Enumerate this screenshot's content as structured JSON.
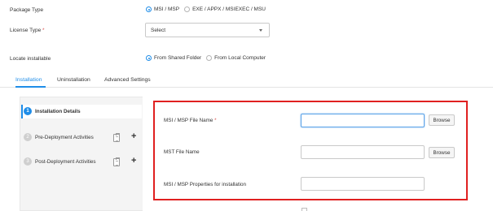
{
  "form": {
    "package_type_label": "Package Type",
    "package_type_options": [
      {
        "label": "MSI / MSP",
        "selected": true
      },
      {
        "label": "EXE / APPX / MSIEXEC / MSU",
        "selected": false
      }
    ],
    "license_type_label": "License Type",
    "required_mark": "*",
    "license_type_value": "Select",
    "locate_label": "Locate installable",
    "locate_options": [
      {
        "label": "From Shared Folder",
        "selected": true
      },
      {
        "label": "From Local Computer",
        "selected": false
      }
    ]
  },
  "tabs": [
    {
      "label": "Installation",
      "active": true
    },
    {
      "label": "Uninstallation",
      "active": false
    },
    {
      "label": "Advanced Settings",
      "active": false
    }
  ],
  "steps": [
    {
      "number": "1",
      "label": "Installation Details",
      "active": true
    },
    {
      "number": "2",
      "label": "Pre-Deployment Activities",
      "active": false
    },
    {
      "number": "3",
      "label": "Post-Deployment Activities",
      "active": false
    }
  ],
  "details": {
    "msi_file_label": "MSI / MSP File Name",
    "msi_file_value": "",
    "mst_file_label": "MST File Name",
    "mst_file_value": "",
    "properties_label": "MSI / MSP Properties for installation",
    "properties_value": "",
    "browse_label": "Browse"
  },
  "colors": {
    "accent": "#1f8de8",
    "highlight_border": "#e02020",
    "required": "#d9534f"
  }
}
